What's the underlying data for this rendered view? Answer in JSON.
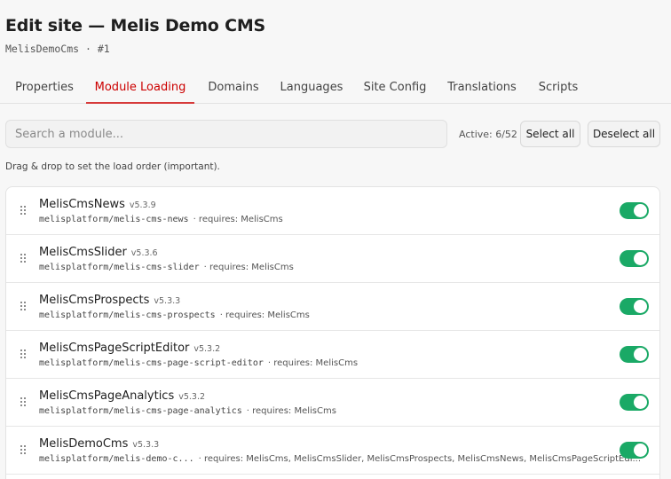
{
  "header": {
    "title": "Edit site — Melis Demo CMS",
    "subtitle": "MelisDemoCms · #1"
  },
  "tabs": [
    {
      "label": "Properties",
      "active": false
    },
    {
      "label": "Module Loading",
      "active": true
    },
    {
      "label": "Domains",
      "active": false
    },
    {
      "label": "Languages",
      "active": false
    },
    {
      "label": "Site Config",
      "active": false
    },
    {
      "label": "Translations",
      "active": false
    },
    {
      "label": "Scripts",
      "active": false
    }
  ],
  "toolbar": {
    "search_placeholder": "Search a module...",
    "active_count": "Active: 6/52",
    "select_all": "Select all",
    "deselect_all": "Deselect all"
  },
  "hint": "Drag & drop to set the load order (important).",
  "colors": {
    "accent": "#d63a3a",
    "toggle_on": "#1aa966"
  },
  "modules": [
    {
      "name": "MelisCmsNews",
      "version": "v5.3.9",
      "package": "melisplatform/melis-cms-news",
      "requires": "· requires: MelisCms",
      "enabled": true
    },
    {
      "name": "MelisCmsSlider",
      "version": "v5.3.6",
      "package": "melisplatform/melis-cms-slider",
      "requires": "· requires: MelisCms",
      "enabled": true
    },
    {
      "name": "MelisCmsProspects",
      "version": "v5.3.3",
      "package": "melisplatform/melis-cms-prospects",
      "requires": "· requires: MelisCms",
      "enabled": true
    },
    {
      "name": "MelisCmsPageScriptEditor",
      "version": "v5.3.2",
      "package": "melisplatform/melis-cms-page-script-editor",
      "requires": "· requires: MelisCms",
      "enabled": true
    },
    {
      "name": "MelisCmsPageAnalytics",
      "version": "v5.3.2",
      "package": "melisplatform/melis-cms-page-analytics",
      "requires": "· requires: MelisCms",
      "enabled": true
    },
    {
      "name": "MelisDemoCms",
      "version": "v5.3.3",
      "package": "melisplatform/melis-demo-c...",
      "requires": "· requires: MelisCms, MelisCmsSlider, MelisCmsProspects, MelisCmsNews, MelisCmsPageScriptEdi...",
      "enabled": true
    }
  ]
}
